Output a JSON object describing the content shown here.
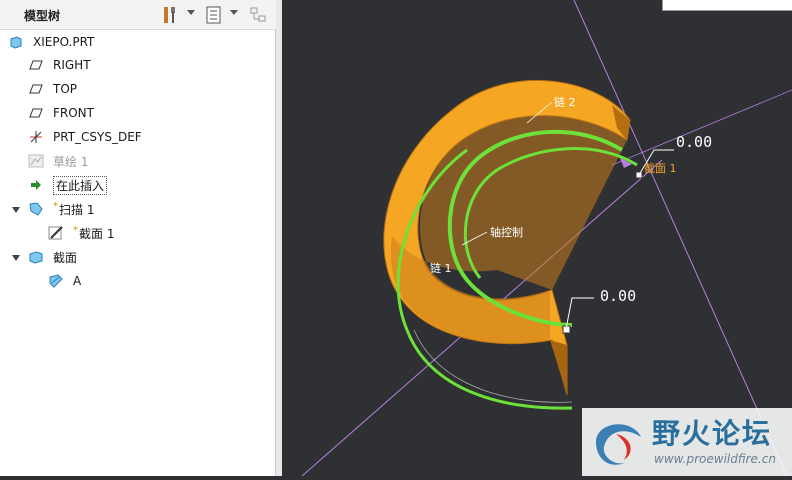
{
  "model_tree": {
    "title": "模型树",
    "items": [
      {
        "label": "XIEPO.PRT",
        "icon": "part-icon"
      },
      {
        "label": "RIGHT",
        "icon": "datum-plane-icon"
      },
      {
        "label": "TOP",
        "icon": "datum-plane-icon"
      },
      {
        "label": "FRONT",
        "icon": "datum-plane-icon"
      },
      {
        "label": "PRT_CSYS_DEF",
        "icon": "csys-icon"
      },
      {
        "label": "草绘 1",
        "icon": "sketch-icon",
        "suppressed": true
      },
      {
        "label": "在此插入",
        "icon": "insert-here-arrow-icon"
      },
      {
        "label": "扫描 1",
        "icon": "sweep-feature-icon",
        "prefix": "*"
      },
      {
        "label": "截面 1",
        "icon": "section-sketch-icon",
        "prefix": "*"
      },
      {
        "label": "截面",
        "icon": "section-group-icon"
      },
      {
        "label": "A",
        "icon": "section-item-icon"
      }
    ]
  },
  "viewport": {
    "background": "#2f3033",
    "model_color": "#f5a623",
    "highlight_color": "#6ee03a",
    "datum_color": "#b77fe0",
    "dimensions": [
      {
        "label": "0.00"
      },
      {
        "label": "0.00"
      }
    ],
    "annotations": [
      "链 2",
      "截面 1",
      "轴控制",
      "链 1"
    ]
  },
  "watermark": {
    "title": "野火论坛",
    "url": "www.proewildfire.cn"
  }
}
